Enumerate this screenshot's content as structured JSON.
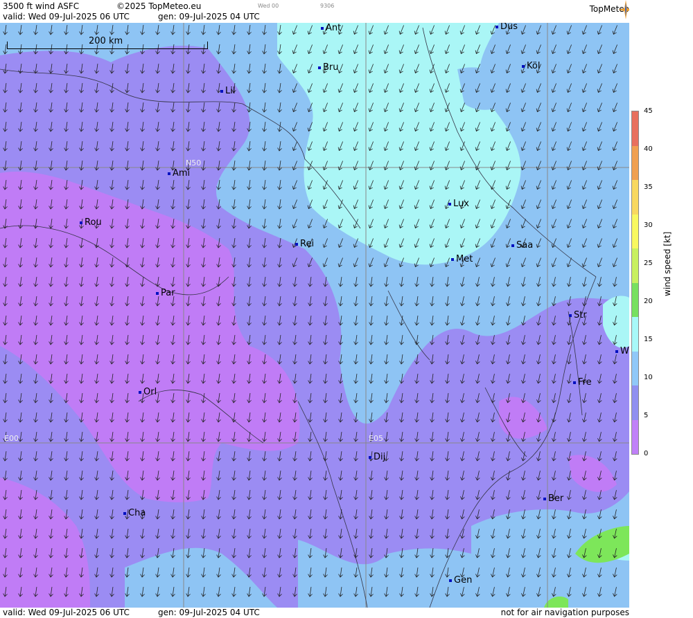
{
  "header": {
    "title": "3500 ft wind ASFC",
    "copyright": "©2025 TopMeteo.eu",
    "mid_small": "Wed 00",
    "code_small": "9306",
    "valid": "valid:  Wed  09-Jul-2025  06 UTC",
    "gen": "gen: 09-Jul-2025 04 UTC",
    "brand": "TopMeteo"
  },
  "footer": {
    "valid": "valid:  Wed  09-Jul-2025  06 UTC",
    "gen": "gen: 09-Jul-2025 04 UTC",
    "disclaimer": "not for air navigation purposes"
  },
  "scale": {
    "label": "200 km"
  },
  "grid_labels": {
    "n50": "N50",
    "e00": "E00",
    "e05": "E05"
  },
  "cities": [
    {
      "name": "Ant"
    },
    {
      "name": "Düs"
    },
    {
      "name": "Bru"
    },
    {
      "name": "Köl"
    },
    {
      "name": "Lil"
    },
    {
      "name": "Ami"
    },
    {
      "name": "Lux"
    },
    {
      "name": "Rou"
    },
    {
      "name": "Rei"
    },
    {
      "name": "Saa"
    },
    {
      "name": "Met"
    },
    {
      "name": "Par"
    },
    {
      "name": "Str"
    },
    {
      "name": "W"
    },
    {
      "name": "Orl"
    },
    {
      "name": "Fre"
    },
    {
      "name": "Dij"
    },
    {
      "name": "Ber"
    },
    {
      "name": "Cha"
    },
    {
      "name": "Gen"
    }
  ],
  "legend": {
    "axis_label": "wind  speed  [kt]",
    "ticks": [
      "45",
      "40",
      "35",
      "30",
      "25",
      "20",
      "15",
      "10",
      "5",
      "0"
    ],
    "colors": [
      "#e8705e",
      "#f0a050",
      "#f8d860",
      "#f8f860",
      "#c8f060",
      "#78e060",
      "#a8f8f8",
      "#90c8f8",
      "#9090f0",
      "#c080f8"
    ]
  },
  "colors": {
    "purple": "#c07cf6",
    "violet": "#9b8cf3",
    "blue": "#8ec4f4",
    "cyan": "#aaf6f6",
    "green": "#7de65a"
  }
}
